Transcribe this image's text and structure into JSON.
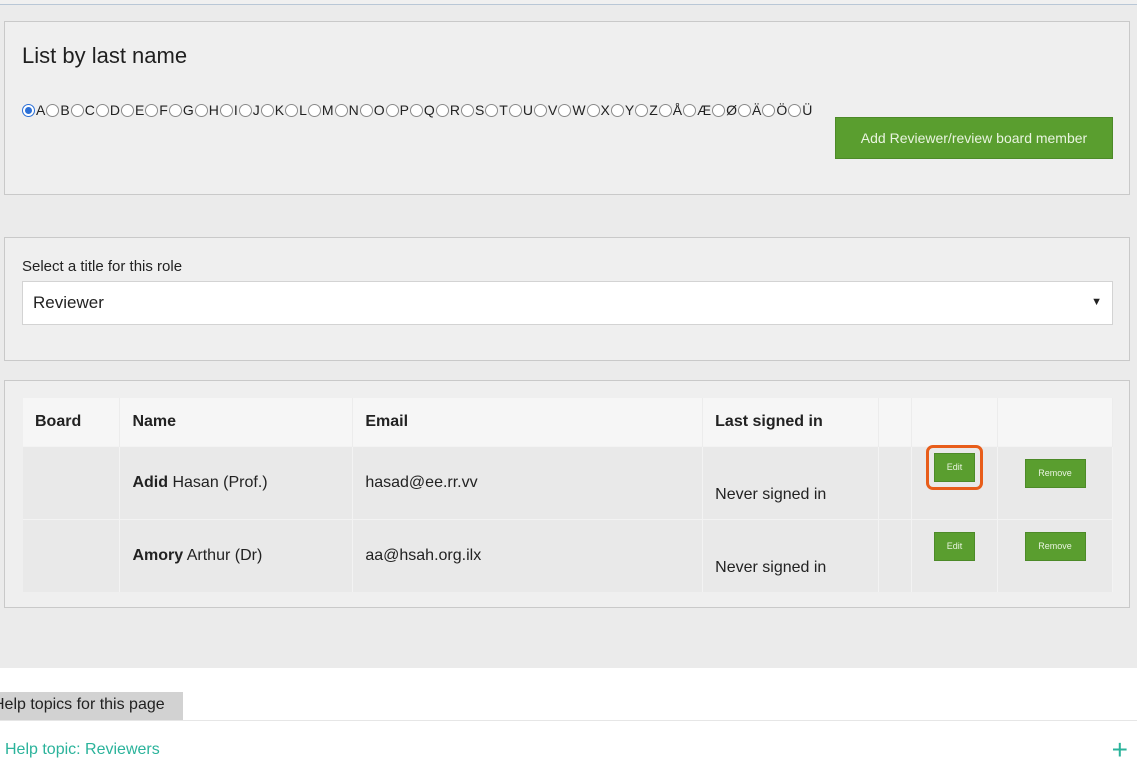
{
  "letter_filter": {
    "title": "List by last name",
    "selected": "A",
    "letters": [
      "A",
      "B",
      "C",
      "D",
      "E",
      "F",
      "G",
      "H",
      "I",
      "J",
      "K",
      "L",
      "M",
      "N",
      "O",
      "P",
      "Q",
      "R",
      "S",
      "T",
      "U",
      "V",
      "W",
      "X",
      "Y",
      "Z",
      "Å",
      "Æ",
      "Ø",
      "Ä",
      "Ö",
      "Ü"
    ],
    "add_button_label": "Add Reviewer/review board member"
  },
  "role": {
    "label": "Select a title for this role",
    "selected_value": "Reviewer",
    "arrow_icon": "caret-down-icon"
  },
  "table": {
    "headers": {
      "board": "Board",
      "name": "Name",
      "email": "Email",
      "last": "Last signed in"
    },
    "rows": [
      {
        "board": "",
        "surname": "Adid",
        "rest": " Hasan (Prof.)",
        "email": "hasad@ee.rr.vv",
        "last": "Never signed in",
        "edit": "Edit",
        "remove": "Remove",
        "highlighted": true
      },
      {
        "board": "",
        "surname": "Amory",
        "rest": " Arthur (Dr)",
        "email": "aa@hsah.org.ilx",
        "last": "Never signed in",
        "edit": "Edit",
        "remove": "Remove",
        "highlighted": false
      }
    ]
  },
  "help": {
    "title": "Help topics for this page",
    "topic": "Help topic: Reviewers",
    "expand_icon": "plus-icon"
  },
  "colors": {
    "button_green": "#5a9e2f",
    "highlight_orange": "#e85d1a",
    "help_link": "#2bb39b"
  }
}
